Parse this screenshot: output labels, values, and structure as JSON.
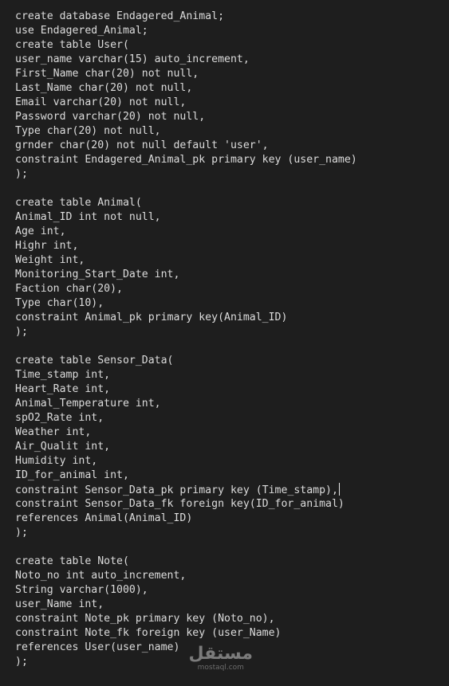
{
  "code_lines": [
    "create database Endagered_Animal;",
    "use Endagered_Animal;",
    "create table User(",
    "user_name varchar(15) auto_increment,",
    "First_Name char(20) not null,",
    "Last_Name char(20) not null,",
    "Email varchar(20) not null,",
    "Password varchar(20) not null,",
    "Type char(20) not null,",
    "grnder char(20) not null default 'user',",
    "constraint Endagered_Animal_pk primary key (user_name)",
    ");",
    "",
    "create table Animal(",
    "Animal_ID int not null,",
    "Age int,",
    "Highr int,",
    "Weight int,",
    "Monitoring_Start_Date int,",
    "Faction char(20),",
    "Type char(10),",
    "constraint Animal_pk primary key(Animal_ID)",
    ");",
    "",
    "create table Sensor_Data(",
    "Time_stamp int,",
    "Heart_Rate int,",
    "Animal_Temperature int,",
    "spO2_Rate int,",
    "Weather int,",
    "Air_Qualit int,",
    "Humidity int,",
    "ID_for_animal int,",
    "constraint Sensor_Data_pk primary key (Time_stamp),",
    "constraint Sensor_Data_fk foreign key(ID_for_animal)",
    "references Animal(Animal_ID)",
    ");",
    "",
    "create table Note(",
    "Noto_no int auto_increment,",
    "String varchar(1000),",
    "user_Name int,",
    "constraint Note_pk primary key (Noto_no),",
    "constraint Note_fk foreign key (user_Name)",
    "references User(user_name)",
    ");"
  ],
  "cursor_line": 33,
  "watermark": {
    "logo_text": "مستقل",
    "url_text": "mostaql.com"
  },
  "colors": {
    "background": "#1e1e1e",
    "text": "#dcdcdc"
  }
}
